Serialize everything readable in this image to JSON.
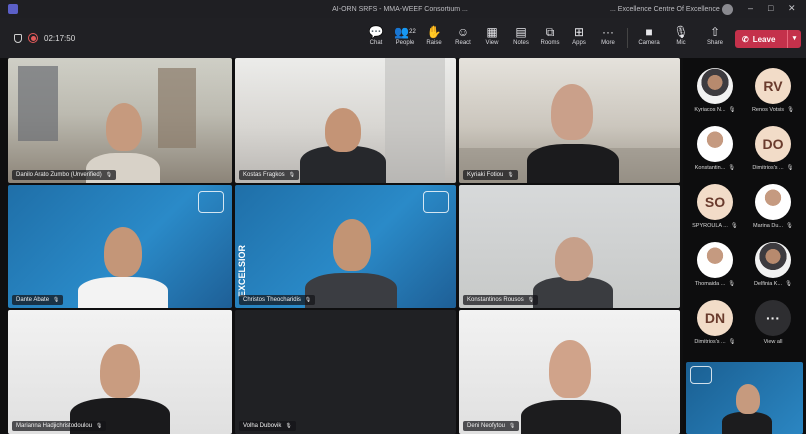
{
  "window": {
    "title": "AI-ORN SRFS - MMA-WEEF Consortium ... ",
    "org": "... Excellence Centre Of Excellence",
    "controls": [
      "–",
      "□",
      "✕"
    ]
  },
  "meeting": {
    "timer": "02:17:50",
    "toolbar": [
      {
        "key": "chat",
        "label": "Chat",
        "icon": "chat-icon",
        "glyph": "💬"
      },
      {
        "key": "people",
        "label": "People",
        "icon": "people-icon",
        "glyph": "👥",
        "count": "22"
      },
      {
        "key": "raise",
        "label": "Raise",
        "icon": "raise-hand-icon",
        "glyph": "✋"
      },
      {
        "key": "react",
        "label": "React",
        "icon": "react-icon",
        "glyph": "☺"
      },
      {
        "key": "view",
        "label": "View",
        "icon": "view-icon",
        "glyph": "▦"
      },
      {
        "key": "notes",
        "label": "Notes",
        "icon": "notes-icon",
        "glyph": "▤"
      },
      {
        "key": "rooms",
        "label": "Rooms",
        "icon": "rooms-icon",
        "glyph": "⧉"
      },
      {
        "key": "apps",
        "label": "Apps",
        "icon": "apps-icon",
        "glyph": "⊞"
      },
      {
        "key": "more",
        "label": "More",
        "icon": "more-icon",
        "glyph": "···"
      },
      {
        "key": "camera",
        "label": "Camera",
        "icon": "camera-icon",
        "glyph": "■"
      },
      {
        "key": "mic",
        "label": "Mic",
        "icon": "mic-icon",
        "glyph": "🎙"
      },
      {
        "key": "share",
        "label": "Share",
        "icon": "share-icon",
        "glyph": "⇧"
      }
    ],
    "leave_label": "Leave"
  },
  "tiles": [
    {
      "name": "Danilo Arato Zumbo (Unverified)"
    },
    {
      "name": "Kostas Fragkos"
    },
    {
      "name": "Kyriaki Fotiou"
    },
    {
      "name": "Dante Abate"
    },
    {
      "name": "Christos Theocharidis"
    },
    {
      "name": "Konstantinos Rousos"
    },
    {
      "name": "Marianna Hadjichristodoulou"
    },
    {
      "name": "Volha Dubovik"
    },
    {
      "name": "Deni Neofytou"
    }
  ],
  "banner_texts": {
    "excelsior": "EXCELSIOR",
    "tile5_banner": "EXCELSIOR"
  },
  "participants": [
    {
      "name": "Kyriacos N...",
      "initials": ""
    },
    {
      "name": "Renos Votsis",
      "initials": "RV"
    },
    {
      "name": "Konstantin...",
      "initials": ""
    },
    {
      "name": "Dimitrios's ...",
      "initials": "DO"
    },
    {
      "name": "SPYROULA ...",
      "initials": "SO"
    },
    {
      "name": "Marina Du...",
      "initials": ""
    },
    {
      "name": "Thomaida ...",
      "initials": ""
    },
    {
      "name": "Delfinia K...",
      "initials": ""
    },
    {
      "name": "Dimitrios's ...",
      "initials": "DN"
    },
    {
      "name": "View all",
      "initials": "···"
    }
  ],
  "colors": {
    "leave_red": "#c4314b",
    "toolbar_bg": "#202024",
    "avatar_initials_bg": "#f2dcc8",
    "banner_blue": "#2a8ac8"
  }
}
